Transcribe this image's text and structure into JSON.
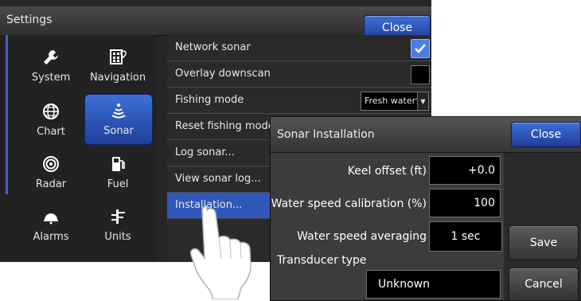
{
  "settings": {
    "title": "Settings",
    "close_label": "Close",
    "categories": [
      {
        "label": "System",
        "icon": "wrench-icon",
        "selected": false
      },
      {
        "label": "Navigation",
        "icon": "calculator-icon",
        "selected": false
      },
      {
        "label": "Chart",
        "icon": "globe-icon",
        "selected": false
      },
      {
        "label": "Sonar",
        "icon": "sonar-icon",
        "selected": true
      },
      {
        "label": "Radar",
        "icon": "radar-icon",
        "selected": false
      },
      {
        "label": "Fuel",
        "icon": "fuel-pump-icon",
        "selected": false
      },
      {
        "label": "Alarms",
        "icon": "alarm-bell-icon",
        "selected": false
      },
      {
        "label": "Units",
        "icon": "units-icon",
        "selected": false
      }
    ],
    "menu": [
      {
        "label": "Network sonar",
        "checked": true
      },
      {
        "label": "Overlay downscan",
        "checked": false
      },
      {
        "label": "Fishing mode",
        "value": "Fresh water*"
      },
      {
        "label": "Reset fishing mode"
      },
      {
        "label": "Log sonar..."
      },
      {
        "label": "View sonar log..."
      },
      {
        "label": "Installation...",
        "active": true
      }
    ]
  },
  "dialog": {
    "title": "Sonar Installation",
    "close_label": "Close",
    "keel_offset": {
      "label": "Keel offset (ft)",
      "value": "+0.0"
    },
    "water_speed_calibration": {
      "label": "Water speed calibration (%)",
      "value": "100"
    },
    "water_speed_averaging": {
      "label": "Water speed averaging",
      "value": "1 sec"
    },
    "transducer_type": {
      "label": "Transducer type",
      "value": "Unknown"
    },
    "save_label": "Save",
    "cancel_label": "Cancel"
  },
  "colors": {
    "accent_blue": "#2f57b7",
    "button_blue": "#3f6ed8",
    "panel_dark": "#262626"
  }
}
